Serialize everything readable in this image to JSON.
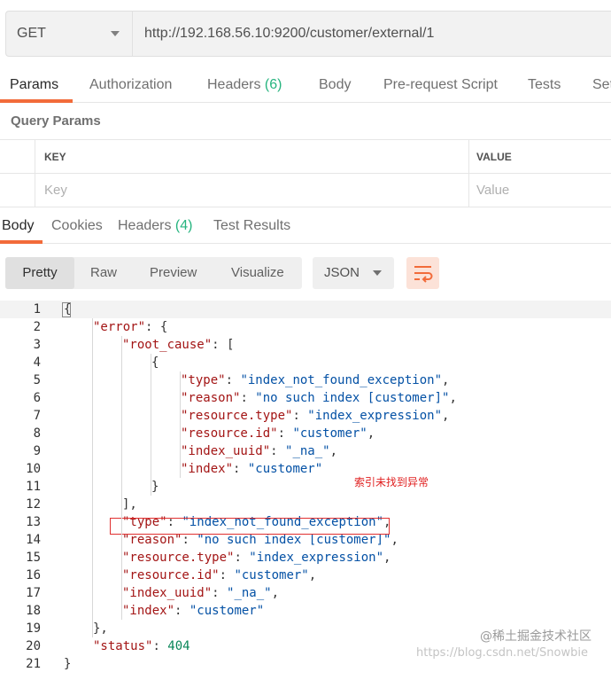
{
  "request": {
    "method": "GET",
    "url": "http://192.168.56.10:9200/customer/external/1"
  },
  "request_tabs": [
    {
      "label": "Params",
      "count": ""
    },
    {
      "label": "Authorization",
      "count": ""
    },
    {
      "label": "Headers ",
      "count": "(6)"
    },
    {
      "label": "Body",
      "count": ""
    },
    {
      "label": "Pre-request Script",
      "count": ""
    },
    {
      "label": "Tests",
      "count": ""
    },
    {
      "label": "Set",
      "count": ""
    }
  ],
  "query_params": {
    "title": "Query Params",
    "columns": {
      "key": "KEY",
      "value": "VALUE"
    },
    "placeholders": {
      "key": "Key",
      "value": "Value"
    }
  },
  "response_tabs": [
    {
      "label": "Body",
      "count": ""
    },
    {
      "label": "Cookies",
      "count": ""
    },
    {
      "label": "Headers ",
      "count": "(4)"
    },
    {
      "label": "Test Results",
      "count": ""
    }
  ],
  "view_modes": [
    "Pretty",
    "Raw",
    "Preview",
    "Visualize"
  ],
  "format": "JSON",
  "code_lines": [
    {
      "n": "1",
      "indent": 0,
      "parts": [
        [
          "p",
          "{"
        ]
      ]
    },
    {
      "n": "2",
      "indent": 1,
      "parts": [
        [
          "k",
          "\"error\""
        ],
        [
          "p",
          ": {"
        ]
      ]
    },
    {
      "n": "3",
      "indent": 2,
      "parts": [
        [
          "k",
          "\"root_cause\""
        ],
        [
          "p",
          ": ["
        ]
      ]
    },
    {
      "n": "4",
      "indent": 3,
      "parts": [
        [
          "p",
          "{"
        ]
      ]
    },
    {
      "n": "5",
      "indent": 4,
      "parts": [
        [
          "k",
          "\"type\""
        ],
        [
          "p",
          ": "
        ],
        [
          "s",
          "\"index_not_found_exception\""
        ],
        [
          "p",
          ","
        ]
      ]
    },
    {
      "n": "6",
      "indent": 4,
      "parts": [
        [
          "k",
          "\"reason\""
        ],
        [
          "p",
          ": "
        ],
        [
          "s",
          "\"no such index [customer]\""
        ],
        [
          "p",
          ","
        ]
      ]
    },
    {
      "n": "7",
      "indent": 4,
      "parts": [
        [
          "k",
          "\"resource.type\""
        ],
        [
          "p",
          ": "
        ],
        [
          "s",
          "\"index_expression\""
        ],
        [
          "p",
          ","
        ]
      ]
    },
    {
      "n": "8",
      "indent": 4,
      "parts": [
        [
          "k",
          "\"resource.id\""
        ],
        [
          "p",
          ": "
        ],
        [
          "s",
          "\"customer\""
        ],
        [
          "p",
          ","
        ]
      ]
    },
    {
      "n": "9",
      "indent": 4,
      "parts": [
        [
          "k",
          "\"index_uuid\""
        ],
        [
          "p",
          ": "
        ],
        [
          "s",
          "\"_na_\""
        ],
        [
          "p",
          ","
        ]
      ]
    },
    {
      "n": "10",
      "indent": 4,
      "parts": [
        [
          "k",
          "\"index\""
        ],
        [
          "p",
          ": "
        ],
        [
          "s",
          "\"customer\""
        ]
      ]
    },
    {
      "n": "11",
      "indent": 3,
      "parts": [
        [
          "p",
          "}"
        ]
      ]
    },
    {
      "n": "12",
      "indent": 2,
      "parts": [
        [
          "p",
          "],"
        ]
      ]
    },
    {
      "n": "13",
      "indent": 2,
      "parts": [
        [
          "k",
          "\"type\""
        ],
        [
          "p",
          ": "
        ],
        [
          "s",
          "\"index_not_found_exception\""
        ],
        [
          "p",
          ","
        ]
      ]
    },
    {
      "n": "14",
      "indent": 2,
      "parts": [
        [
          "k",
          "\"reason\""
        ],
        [
          "p",
          ": "
        ],
        [
          "s",
          "\"no such index [customer]\""
        ],
        [
          "p",
          ","
        ]
      ]
    },
    {
      "n": "15",
      "indent": 2,
      "parts": [
        [
          "k",
          "\"resource.type\""
        ],
        [
          "p",
          ": "
        ],
        [
          "s",
          "\"index_expression\""
        ],
        [
          "p",
          ","
        ]
      ]
    },
    {
      "n": "16",
      "indent": 2,
      "parts": [
        [
          "k",
          "\"resource.id\""
        ],
        [
          "p",
          ": "
        ],
        [
          "s",
          "\"customer\""
        ],
        [
          "p",
          ","
        ]
      ]
    },
    {
      "n": "17",
      "indent": 2,
      "parts": [
        [
          "k",
          "\"index_uuid\""
        ],
        [
          "p",
          ": "
        ],
        [
          "s",
          "\"_na_\""
        ],
        [
          "p",
          ","
        ]
      ]
    },
    {
      "n": "18",
      "indent": 2,
      "parts": [
        [
          "k",
          "\"index\""
        ],
        [
          "p",
          ": "
        ],
        [
          "s",
          "\"customer\""
        ]
      ]
    },
    {
      "n": "19",
      "indent": 1,
      "parts": [
        [
          "p",
          "},"
        ]
      ]
    },
    {
      "n": "20",
      "indent": 1,
      "parts": [
        [
          "k",
          "\"status\""
        ],
        [
          "p",
          ": "
        ],
        [
          "n",
          "404"
        ]
      ]
    },
    {
      "n": "21",
      "indent": 0,
      "parts": [
        [
          "p",
          "}"
        ]
      ]
    }
  ],
  "annotation": "索引未找到异常",
  "watermark": {
    "logo": "@稀土掘金技术社区",
    "url": "https://blog.csdn.net/Snowbie"
  },
  "colors": {
    "accent": "#f26b3a",
    "count": "#26b47f",
    "json_key": "#a31515",
    "json_string": "#0451a5",
    "json_number": "#098658",
    "highlight": "#e03030"
  }
}
